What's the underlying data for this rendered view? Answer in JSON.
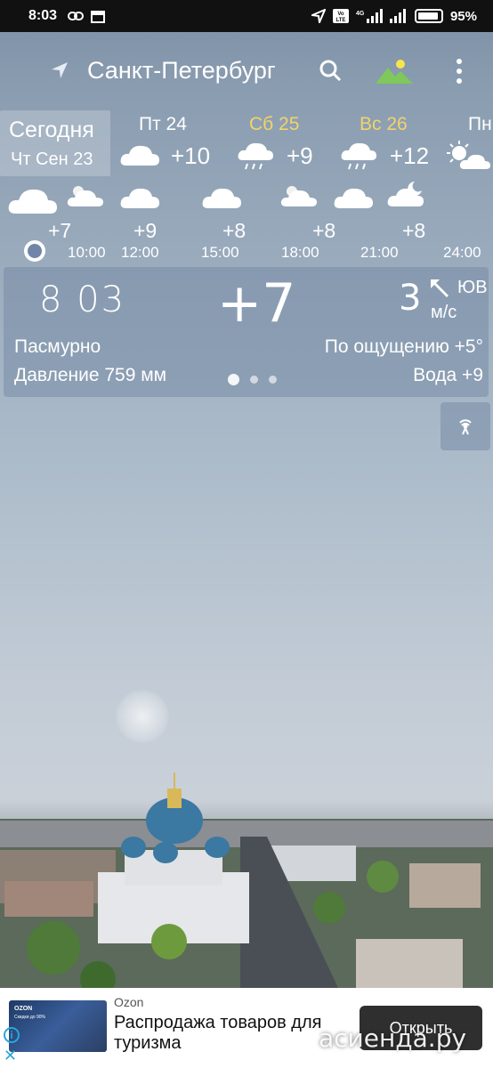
{
  "status_bar": {
    "time": "8:03",
    "battery": "95%",
    "icons": [
      "link-icon",
      "calendar-icon",
      "location-icon",
      "volte-icon",
      "signal-4g-icon",
      "signal-icon",
      "battery-icon"
    ]
  },
  "header": {
    "city": "Санкт-Петербург",
    "icons": [
      "location-arrow-icon",
      "search-icon",
      "landscape-icon",
      "more-vert-icon"
    ]
  },
  "daily": {
    "today": {
      "label": "Сегодня",
      "date": "Чт Сен 23"
    },
    "days": [
      {
        "name": "Пт 24",
        "temp": "+10",
        "icon": "cloud-icon",
        "weekend": false
      },
      {
        "name": "Сб 25",
        "temp": "+9",
        "icon": "rain-cloud-icon",
        "weekend": true
      },
      {
        "name": "Вс 26",
        "temp": "+12",
        "icon": "rain-cloud-icon",
        "weekend": true
      },
      {
        "name": "Пн",
        "temp": "",
        "icon": "sun-cloud-icon",
        "weekend": false
      }
    ]
  },
  "hourly": [
    {
      "temp": "+7",
      "time": "10:00",
      "icon": "cloud-icon"
    },
    {
      "temp": "+9",
      "time": "12:00",
      "icon": "cloud-icon"
    },
    {
      "temp": "+8",
      "time": "15:00",
      "icon": "cloud-icon"
    },
    {
      "temp": "+8",
      "time": "18:00",
      "icon": "cloud-icon"
    },
    {
      "temp": "+8",
      "time": "21:00",
      "icon": "cloud-icon"
    },
    {
      "temp": "",
      "time": "24:00",
      "icon": "moon-cloud-icon"
    }
  ],
  "current": {
    "time": "8 03",
    "temp": "+7",
    "wind_speed": "3",
    "wind_dir": "ЮВ",
    "wind_unit": "м/с",
    "condition": "Пасмурно",
    "feels_like": "По ощущению +5°",
    "pressure": "Давление 759 мм",
    "water": "Вода +9"
  },
  "ad": {
    "source": "Ozon",
    "title": "Распродажа товаров для туризма",
    "open_label": "Открыть",
    "thumb_brand": "OZON",
    "thumb_sub": "Скидки до 90%"
  },
  "watermark": "асиенда.ру",
  "colors": {
    "weekend": "#f2d36b",
    "panel": "#8ea0b8",
    "ad_button": "#2f2f2f",
    "ad_info": "#2aa6d8"
  }
}
